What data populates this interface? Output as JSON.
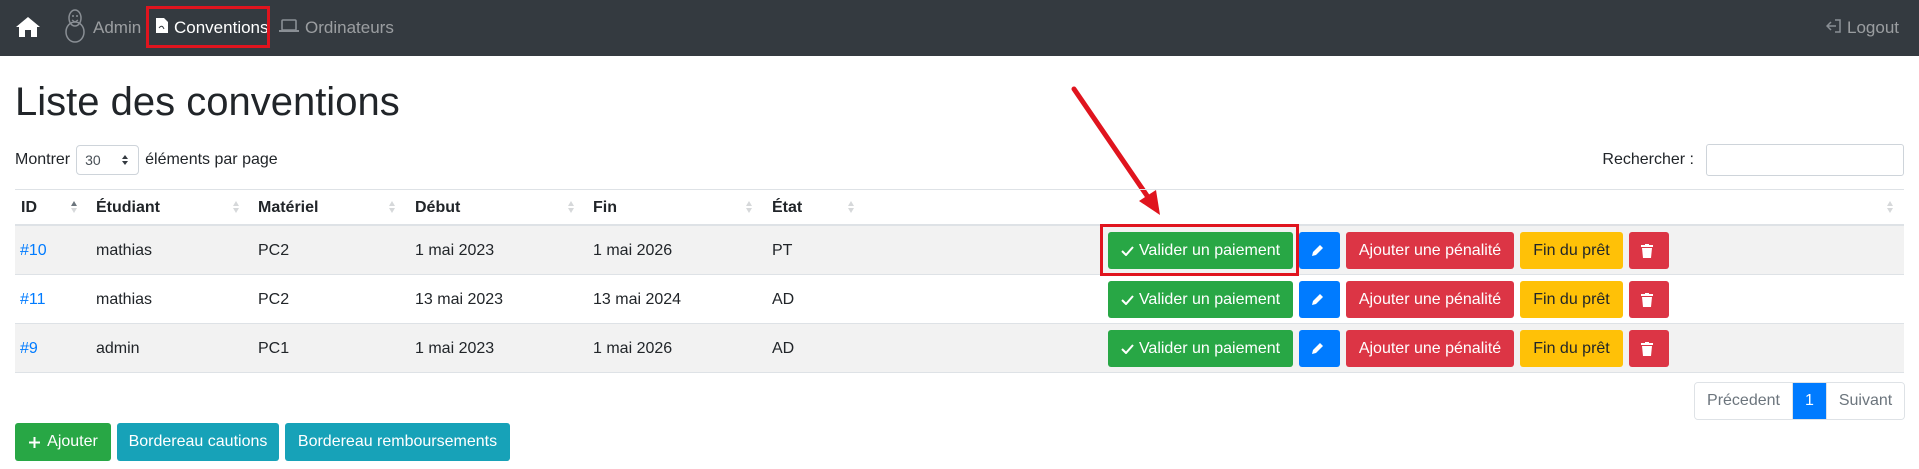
{
  "navbar": {
    "admin": "Admin",
    "conventions": "Conventions",
    "ordinateurs": "Ordinateurs",
    "logout": "Logout",
    "icons": {
      "home": "home-icon",
      "admin": "linux-penguin-icon",
      "conventions": "file-pdf-icon",
      "ordinateurs": "laptop-icon",
      "logout": "sign-out-icon"
    }
  },
  "page": {
    "title": "Liste des conventions"
  },
  "controls": {
    "show_prefix": "Montrer",
    "page_length": "30",
    "show_suffix": "éléments par page",
    "search_label": "Rechercher :",
    "search_value": ""
  },
  "table": {
    "headers": [
      "ID",
      "Étudiant",
      "Matériel",
      "Début",
      "Fin",
      "État",
      ""
    ],
    "rows": [
      {
        "id": "#10",
        "etudiant": "mathias",
        "materiel": "PC2",
        "debut": "1 mai 2023",
        "fin": "1 mai 2026",
        "etat": "PT"
      },
      {
        "id": "#11",
        "etudiant": "mathias",
        "materiel": "PC2",
        "debut": "13 mai 2023",
        "fin": "13 mai 2024",
        "etat": "AD"
      },
      {
        "id": "#9",
        "etudiant": "admin",
        "materiel": "PC1",
        "debut": "1 mai 2023",
        "fin": "1 mai 2026",
        "etat": "AD"
      }
    ],
    "actions": {
      "validate": "Valider un paiement",
      "penalty": "Ajouter une pénalité",
      "end": "Fin du prêt"
    }
  },
  "pagination": {
    "prev": "Précedent",
    "current": "1",
    "next": "Suivant"
  },
  "bottom": {
    "add": "Ajouter",
    "caution": "Bordereau cautions",
    "refund": "Bordereau remboursements"
  },
  "colors": {
    "navbar": "#343a40",
    "success": "#28a745",
    "primary": "#007bff",
    "danger": "#dc3545",
    "warning": "#ffc107",
    "info": "#17a2b8",
    "highlight": "#e0141e"
  }
}
